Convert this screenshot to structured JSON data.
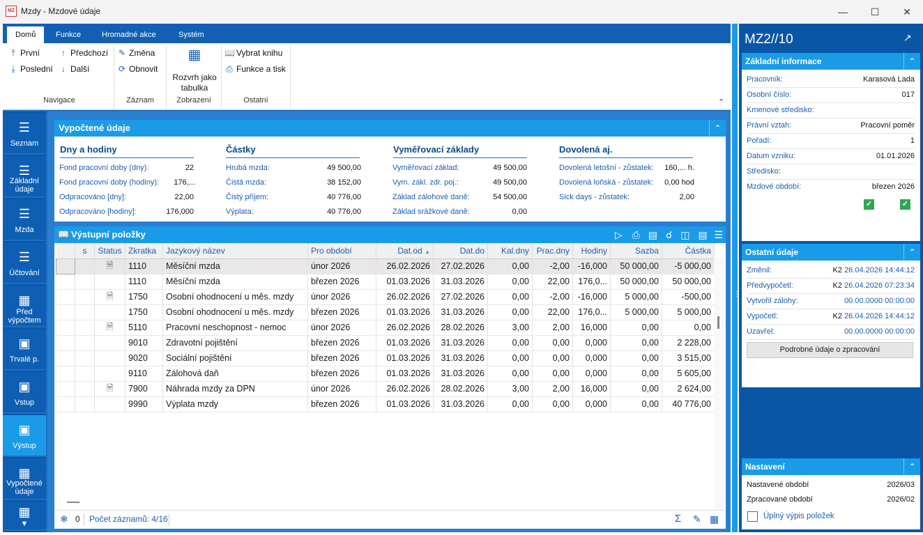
{
  "window": {
    "title": "Mzdy - Mzdové údaje",
    "icon_text": "MZ"
  },
  "ribbon": {
    "tabs": [
      "Domů",
      "Funkce",
      "Hromadné akce",
      "Systém"
    ],
    "nav": {
      "first": "První",
      "last": "Poslední",
      "prev": "Předchozí",
      "next": "Další",
      "group": "Navigace"
    },
    "record": {
      "edit": "Změna",
      "refresh": "Obnovit",
      "group": "Záznam"
    },
    "view": {
      "table": "Rozvrh jako tabulka",
      "group": "Zobrazení"
    },
    "other": {
      "book": "Vybrat knihu",
      "print": "Funkce a tisk",
      "group": "Ostatní"
    }
  },
  "leftnav": [
    "Seznam",
    "Základní údaje",
    "Mzda",
    "Účtování",
    "Před výpočtem",
    "Trvalé p.",
    "Vstup",
    "Výstup",
    "Vypočtené údaje"
  ],
  "computed": {
    "title": "Vypočtené údaje",
    "cols": [
      {
        "head": "Dny a hodiny",
        "rows": [
          [
            "Fond pracovní doby (dny):",
            "22"
          ],
          [
            "Fond pracovní doby (hodiny):",
            "176,..."
          ],
          [
            "Odpracováno [dny]:",
            "22,00"
          ],
          [
            "Odpracováno [hodiny]:",
            "176,000"
          ]
        ]
      },
      {
        "head": "Částky",
        "rows": [
          [
            "Hrubá mzda:",
            "49 500,00"
          ],
          [
            "Čistá mzda:",
            "38 152,00"
          ],
          [
            "Čistý příjem:",
            "40 776,00"
          ],
          [
            "Výplata:",
            "40 776,00"
          ]
        ]
      },
      {
        "head": "Vyměřovací základy",
        "rows": [
          [
            "Vyměřovací základ:",
            "49 500,00"
          ],
          [
            "Vym. zákl. zdr. poj.:",
            "49 500,00"
          ],
          [
            "Základ zálohové daně:",
            "54 500,00"
          ],
          [
            "Základ srážkové daně:",
            "0,00"
          ]
        ]
      },
      {
        "head": "Dovolená aj.",
        "rows": [
          [
            "Dovolená letošní - zůstatek:",
            "160,... h."
          ],
          [
            "Dovolená loňská - zůstatek:",
            "0,00 hod"
          ],
          [
            "Sick days - zůstatek:",
            "2,00"
          ]
        ]
      }
    ]
  },
  "output": {
    "title": "Výstupní položky",
    "headers": [
      "",
      "s",
      "Status",
      "Zkratka",
      "Jazykový název",
      "Pro období",
      "Dat.od",
      "Dat.do",
      "Kal.dny",
      "Prac.dny",
      "Hodiny",
      "Sazba",
      "Částka"
    ],
    "rows": [
      [
        "",
        "",
        "doc",
        "1110",
        "Měsíční mzda",
        "únor 2026",
        "26.02.2026",
        "27.02.2026",
        "0,00",
        "-2,00",
        "-16,000",
        "50 000,00",
        "-5 000,00"
      ],
      [
        "",
        "",
        "",
        "1110",
        "Měsíční mzda",
        "březen 2026",
        "01.03.2026",
        "31.03.2026",
        "0,00",
        "22,00",
        "176,0...",
        "50 000,00",
        "50 000,00"
      ],
      [
        "",
        "",
        "doc",
        "1750",
        "Osobní ohodnocení u měs. mzdy",
        "únor 2026",
        "26.02.2026",
        "27.02.2026",
        "0,00",
        "-2,00",
        "-16,000",
        "5 000,00",
        "-500,00"
      ],
      [
        "",
        "",
        "",
        "1750",
        "Osobní ohodnocení u měs. mzdy",
        "březen 2026",
        "01.03.2026",
        "31.03.2026",
        "0,00",
        "22,00",
        "176,0...",
        "5 000,00",
        "5 000,00"
      ],
      [
        "",
        "",
        "doc",
        "5110",
        "Pracovní neschopnost - nemoc",
        "únor 2026",
        "26.02.2026",
        "28.02.2026",
        "3,00",
        "2,00",
        "16,000",
        "0,00",
        "0,00"
      ],
      [
        "",
        "",
        "",
        "9010",
        "Zdravotní pojištění",
        "březen 2026",
        "01.03.2026",
        "31.03.2026",
        "0,00",
        "0,00",
        "0,000",
        "0,00",
        "2 228,00"
      ],
      [
        "",
        "",
        "",
        "9020",
        "Sociální pojištění",
        "březen 2026",
        "01.03.2026",
        "31.03.2026",
        "0,00",
        "0,00",
        "0,000",
        "0,00",
        "3 515,00"
      ],
      [
        "",
        "",
        "",
        "9110",
        "Zálohová daň",
        "březen 2026",
        "01.03.2026",
        "31.03.2026",
        "0,00",
        "0,00",
        "0,000",
        "0,00",
        "5 605,00"
      ],
      [
        "",
        "",
        "doc",
        "7900",
        "Náhrada mzdy za DPN",
        "únor 2026",
        "26.02.2026",
        "28.02.2026",
        "3,00",
        "2,00",
        "16,000",
        "0,00",
        "2 624,00"
      ],
      [
        "",
        "",
        "",
        "9990",
        "Výplata mzdy",
        "březen 2026",
        "01.03.2026",
        "31.03.2026",
        "0,00",
        "0,00",
        "0,000",
        "0,00",
        "40 776,00"
      ]
    ],
    "status": {
      "filter_count": "0",
      "records": "Počet záznamů: 4/16"
    }
  },
  "right": {
    "record_id": "MZ2//10",
    "basic": {
      "title": "Základní informace",
      "rows": [
        [
          "Pracovník:",
          "Karasová Lada"
        ],
        [
          "Osobní číslo:",
          "017"
        ],
        [
          "Kmenové středisko:",
          ""
        ],
        [
          "Právní vztah:",
          "Pracovní poměr"
        ],
        [
          "Pořadí:",
          "1"
        ],
        [
          "Datum vzniku:",
          "01.01.2026"
        ],
        [
          "Středisko:",
          ""
        ],
        [
          "Mzdové období:",
          "březen 2026"
        ]
      ]
    },
    "other": {
      "title": "Ostatní údaje",
      "rows": [
        [
          "Změnil:",
          "K2",
          "26.04.2026 14:44:12"
        ],
        [
          "Předvypočetl:",
          "K2",
          "26.04.2026 07:23:34"
        ],
        [
          "Vytvořil zálohy:",
          "",
          "00.00.0000 00:00:00"
        ],
        [
          "Vypočetl:",
          "K2",
          "26.04.2026 14:44:12"
        ],
        [
          "Uzavřel:",
          "",
          "00.00.0000 00:00:00"
        ]
      ],
      "button": "Podrobné údaje o zpracování"
    },
    "settings": {
      "title": "Nastavení",
      "rows": [
        [
          "Nastavené období",
          "2026/03"
        ],
        [
          "Zpracované období",
          "2026/02"
        ]
      ],
      "checkbox": "Úplný výpis položek"
    }
  }
}
